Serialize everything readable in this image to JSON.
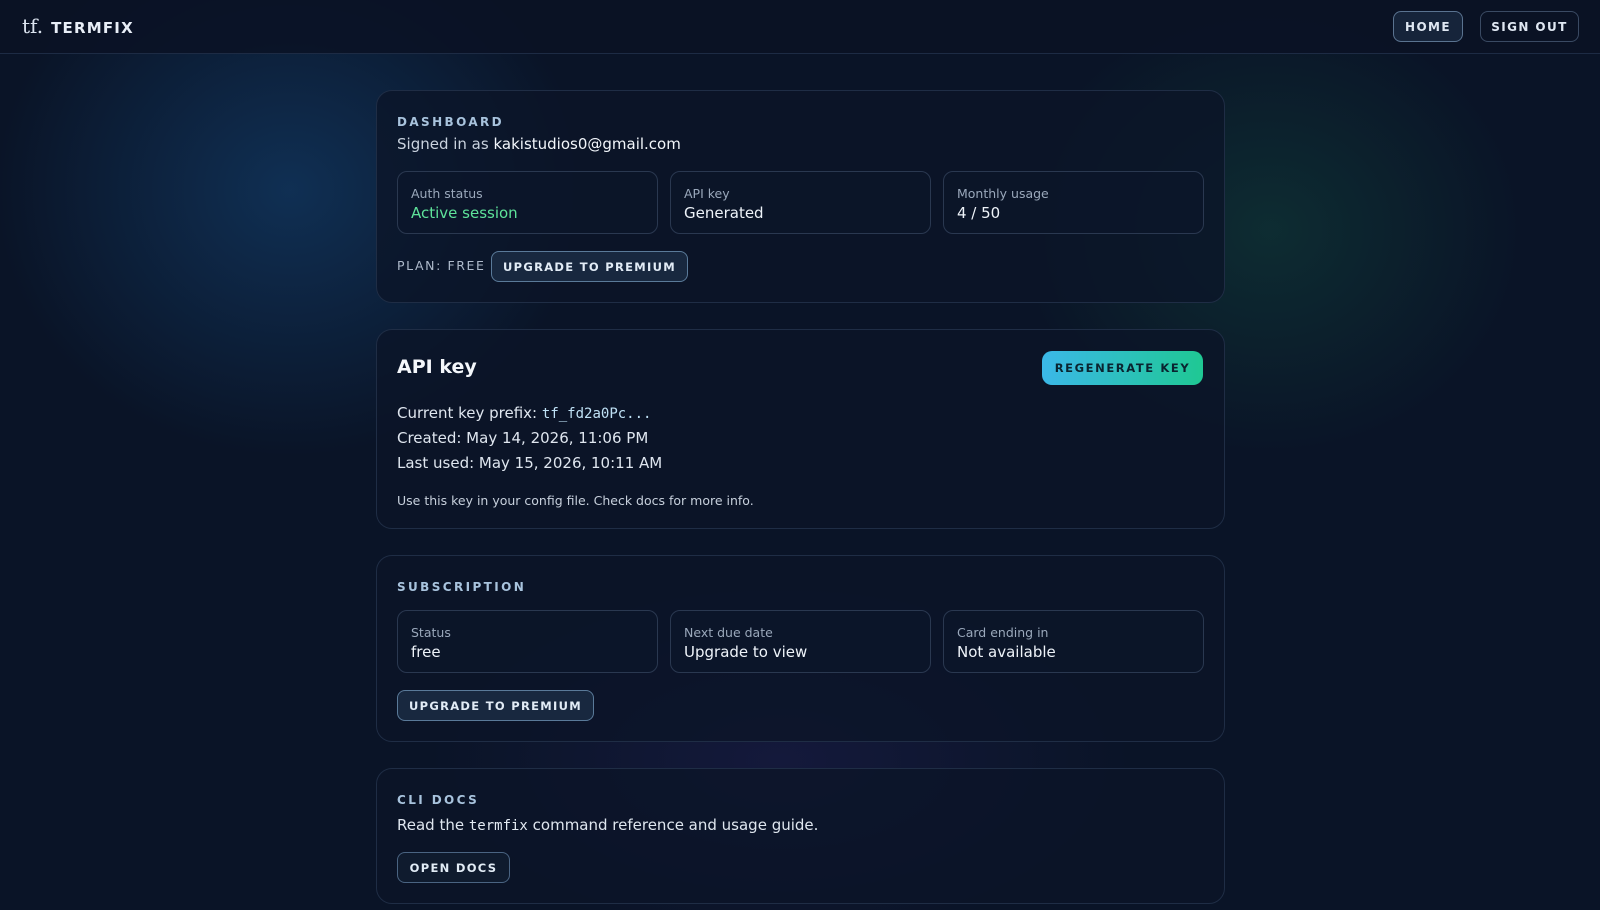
{
  "header": {
    "logo": "tf.",
    "brand": "TERMFIX",
    "nav": {
      "home": "HOME",
      "sign_out": "SIGN OUT"
    }
  },
  "dashboard": {
    "eyebrow": "DASHBOARD",
    "signed_in_prefix": "Signed in as",
    "email": "kakistudios0@gmail.com",
    "tiles": [
      {
        "label": "Auth status",
        "value": "Active session"
      },
      {
        "label": "API key",
        "value": "Generated"
      },
      {
        "label": "Monthly usage",
        "value": "4 / 50"
      }
    ],
    "plan_label": "PLAN: FREE",
    "upgrade_label": "UPGRADE TO PREMIUM"
  },
  "api_key": {
    "title": "API key",
    "regenerate_label": "REGENERATE KEY",
    "prefix_label": "Current key prefix:",
    "prefix_value": "tf_fd2a0Pc...",
    "created": "Created: May 14, 2026, 11:06 PM",
    "last_used": "Last used: May 15, 2026, 10:11 AM",
    "note": "Use this key in your config file. Check docs for more info."
  },
  "subscription": {
    "eyebrow": "SUBSCRIPTION",
    "tiles": [
      {
        "label": "Status",
        "value": "free"
      },
      {
        "label": "Next due date",
        "value": "Upgrade to view"
      },
      {
        "label": "Card ending in",
        "value": "Not available"
      }
    ],
    "upgrade_label": "UPGRADE TO PREMIUM"
  },
  "cli_docs": {
    "eyebrow": "CLI DOCS",
    "text_before": "Read the",
    "command": "termfix",
    "text_after": "command reference and usage guide.",
    "open_label": "OPEN DOCS"
  },
  "colors": {
    "background": "#0a1427",
    "accent_green": "#5ee39a",
    "gradient_start": "#3bb8e8",
    "gradient_end": "#1fc893"
  }
}
